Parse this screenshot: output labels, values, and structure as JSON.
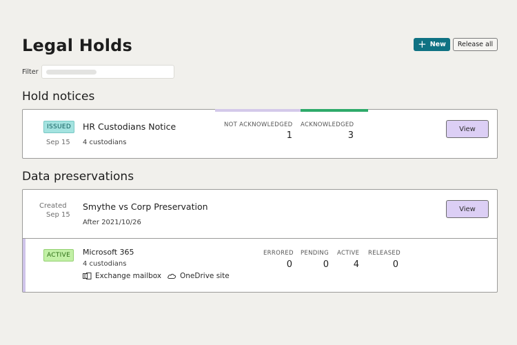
{
  "header": {
    "title": "Legal Holds",
    "new_label": "New",
    "release_label": "Release all"
  },
  "filter": {
    "label": "Filter",
    "value": ""
  },
  "hold_notices": {
    "section_title": "Hold notices",
    "items": [
      {
        "status": "ISSUED",
        "date": "Sep 15",
        "title": "HR Custodians Notice",
        "custodians": "4 custodians",
        "stats": [
          {
            "label": "NOT ACKNOWLEDGED",
            "value": "1",
            "color": "#d4c9ea"
          },
          {
            "label": "ACKNOWLEDGED",
            "value": "3",
            "color": "#2eaa6a"
          }
        ],
        "view_label": "View"
      }
    ]
  },
  "data_preservations": {
    "section_title": "Data preservations",
    "item": {
      "created_label": "Created",
      "date": "Sep 15",
      "title": "Smythe vs Corp Preservation",
      "subtitle": "After 2021/10/26",
      "view_label": "View",
      "sources": [
        {
          "status": "ACTIVE",
          "name": "Microsoft 365",
          "custodians": "4 custodians",
          "resources": [
            {
              "icon": "exchange-icon",
              "label": "Exchange mailbox"
            },
            {
              "icon": "cloud-icon",
              "label": "OneDrive site"
            }
          ],
          "stats": [
            {
              "label": "ERRORED",
              "value": "0"
            },
            {
              "label": "PENDING",
              "value": "0"
            },
            {
              "label": "ACTIVE",
              "value": "4"
            },
            {
              "label": "RELEASED",
              "value": "0"
            }
          ]
        }
      ]
    }
  }
}
